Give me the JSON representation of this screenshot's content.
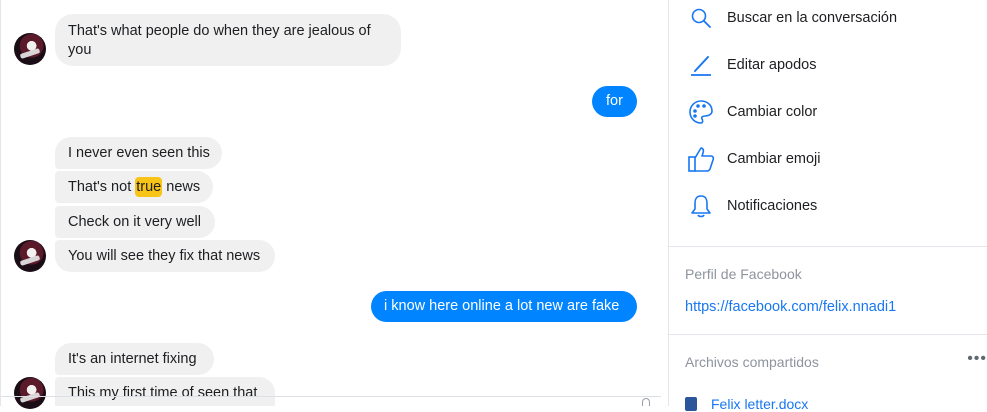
{
  "messages": [
    {
      "dir": "in",
      "text": "That's what people do when they are jealous of",
      "text2": "you"
    },
    {
      "dir": "out",
      "text": "for"
    },
    {
      "dir": "in",
      "text": "I never even seen this"
    },
    {
      "dir": "in",
      "pre": "That's not ",
      "hl": "true",
      "post": " news"
    },
    {
      "dir": "in",
      "text": "Check on it very well"
    },
    {
      "dir": "in",
      "text": "You will see they fix that news"
    },
    {
      "dir": "out",
      "text": "i know here online a lot new are fake"
    },
    {
      "dir": "in",
      "text": "It's an internet fixing"
    },
    {
      "dir": "in",
      "text": "This my first time of seen that"
    }
  ],
  "options": [
    {
      "icon": "search-icon",
      "label": "Buscar en la conversación"
    },
    {
      "icon": "pencil-icon",
      "label": "Editar apodos"
    },
    {
      "icon": "palette-icon",
      "label": "Cambiar color"
    },
    {
      "icon": "thumbs-up-icon",
      "label": "Cambiar emoji"
    },
    {
      "icon": "bell-icon",
      "label": "Notificaciones"
    }
  ],
  "profile": {
    "title": "Perfil de Facebook",
    "url": "https://facebook.com/felix.nnadi1"
  },
  "shared": {
    "title": "Archivos compartidos",
    "more": "•••",
    "file": "Felix letter.docx"
  },
  "colors": {
    "accent": "#0084ff",
    "link": "#1877f2",
    "highlight": "#f7c417"
  }
}
